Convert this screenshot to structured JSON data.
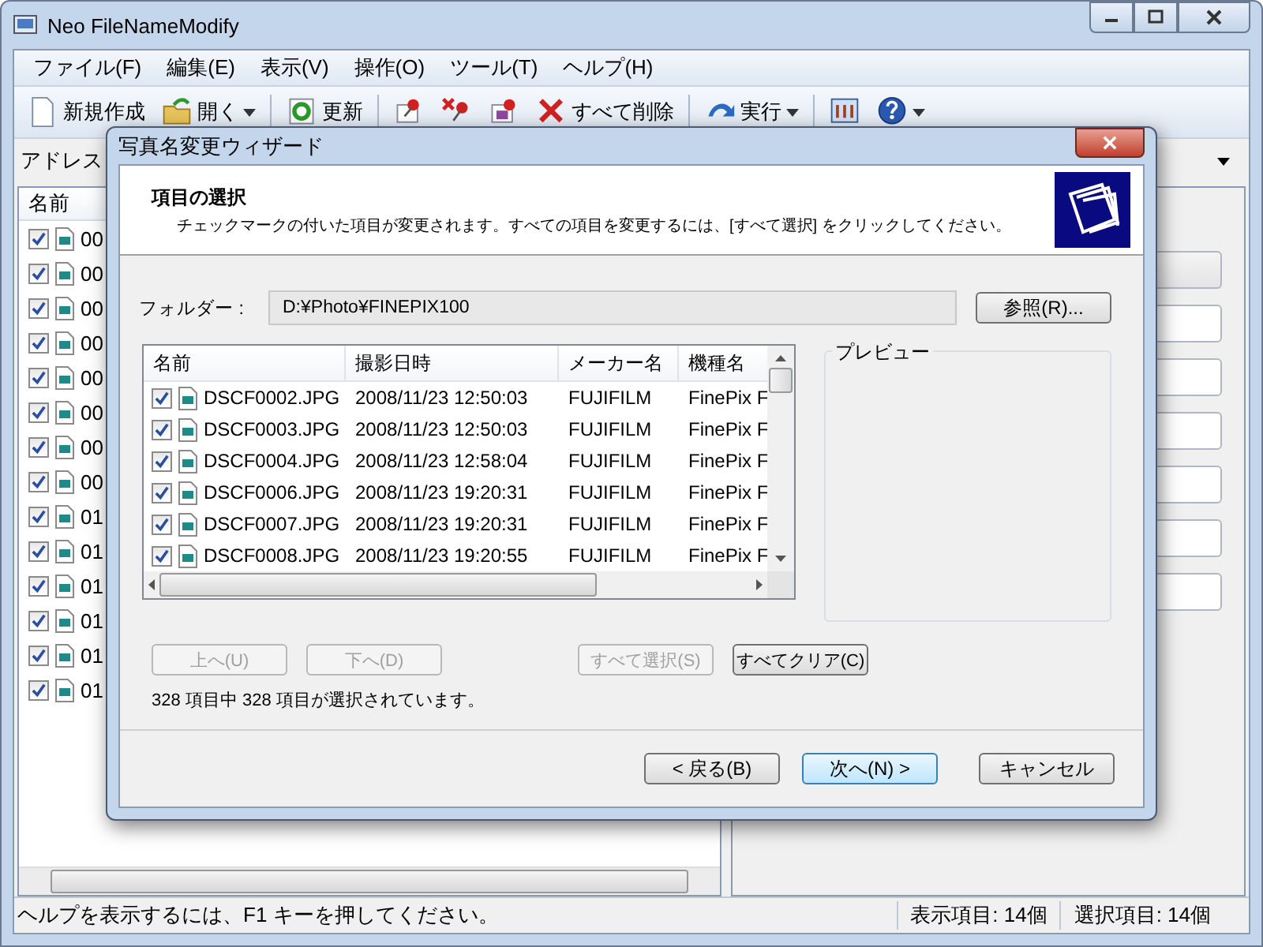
{
  "window": {
    "title": "Neo FileNameModify"
  },
  "menu": [
    "ファイル(F)",
    "編集(E)",
    "表示(V)",
    "操作(O)",
    "ツール(T)",
    "ヘルプ(H)"
  ],
  "toolbar": [
    {
      "kind": "new",
      "label": "新規作成"
    },
    {
      "kind": "open",
      "label": "開く",
      "dropdown": true
    },
    {
      "kind": "refresh",
      "label": "更新"
    },
    {
      "kind": "pin"
    },
    {
      "kind": "pin-remove"
    },
    {
      "kind": "pin-photo"
    },
    {
      "kind": "delete",
      "label": "すべて削除"
    },
    {
      "kind": "run",
      "label": "実行",
      "dropdown": true
    },
    {
      "kind": "tools"
    },
    {
      "kind": "help",
      "dropdown": true
    }
  ],
  "address": {
    "label": "アドレス"
  },
  "file_list": {
    "columns": [
      "名前"
    ],
    "rows": [
      {
        "name": "00",
        "checked": true
      },
      {
        "name": "00",
        "checked": true
      },
      {
        "name": "00",
        "checked": true
      },
      {
        "name": "00",
        "checked": true
      },
      {
        "name": "00",
        "checked": true
      },
      {
        "name": "00",
        "checked": true
      },
      {
        "name": "00",
        "checked": true
      },
      {
        "name": "00",
        "checked": true
      },
      {
        "name": "01",
        "checked": true
      },
      {
        "name": "01",
        "checked": true
      },
      {
        "name": "01",
        "checked": true
      },
      {
        "name": "01",
        "checked": true
      },
      {
        "name": "01",
        "checked": true
      },
      {
        "name": "01",
        "checked": true
      }
    ]
  },
  "status_bar": {
    "help": "ヘルプを表示するには、F1 キーを押してください。",
    "shown": "表示項目: 14個",
    "selected": "選択項目: 14個"
  },
  "dialog": {
    "title": "写真名変更ウィザード",
    "heading": "項目の選択",
    "description": "チェックマークの付いた項目が変更されます。すべての項目を変更するには、[すべて選択] をクリックしてください。",
    "folder": {
      "label": "フォルダー :",
      "value": "D:¥Photo¥FINEPIX100",
      "browse": "参照(R)..."
    },
    "columns": [
      "名前",
      "撮影日時",
      "メーカー名",
      "機種名"
    ],
    "rows": [
      {
        "checked": true,
        "name": "DSCF0002.JPG",
        "date": "2008/11/23 12:50:03",
        "maker": "FUJIFILM",
        "model": "FinePix F"
      },
      {
        "checked": true,
        "name": "DSCF0003.JPG",
        "date": "2008/11/23 12:50:03",
        "maker": "FUJIFILM",
        "model": "FinePix F"
      },
      {
        "checked": true,
        "name": "DSCF0004.JPG",
        "date": "2008/11/23 12:58:04",
        "maker": "FUJIFILM",
        "model": "FinePix F"
      },
      {
        "checked": true,
        "name": "DSCF0006.JPG",
        "date": "2008/11/23 19:20:31",
        "maker": "FUJIFILM",
        "model": "FinePix F"
      },
      {
        "checked": true,
        "name": "DSCF0007.JPG",
        "date": "2008/11/23 19:20:31",
        "maker": "FUJIFILM",
        "model": "FinePix F"
      },
      {
        "checked": true,
        "name": "DSCF0008.JPG",
        "date": "2008/11/23 19:20:55",
        "maker": "FUJIFILM",
        "model": "FinePix F"
      }
    ],
    "preview_label": "プレビュー",
    "list_buttons": [
      {
        "label": "上へ(U)",
        "disabled": true
      },
      {
        "label": "下へ(D)",
        "disabled": true
      },
      {
        "label": "すべて選択(S)",
        "disabled": true
      },
      {
        "label": "すべてクリア(C)",
        "disabled": false
      }
    ],
    "count": "328 項目中 328 項目が選択されています。",
    "nav_buttons": [
      {
        "label": "< 戻る(B)",
        "default": false
      },
      {
        "label": "次へ(N) >",
        "default": true
      },
      {
        "label": "キャンセル",
        "default": false
      }
    ]
  }
}
